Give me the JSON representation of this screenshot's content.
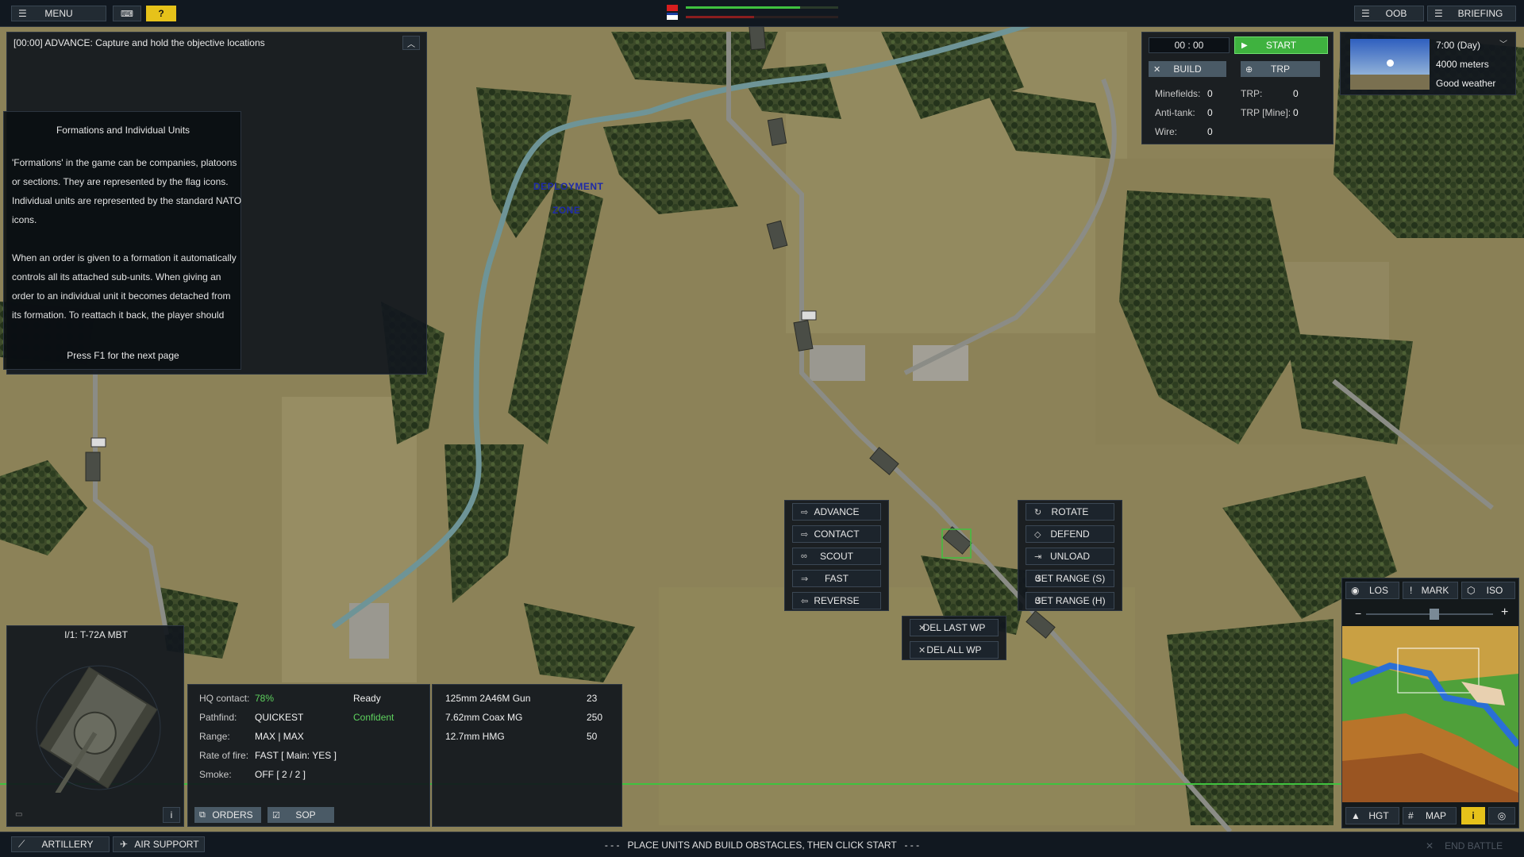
{
  "topbar": {
    "menu_label": "MENU",
    "help_label": "?",
    "oob_label": "OOB",
    "briefing_label": "BRIEFING"
  },
  "mission": {
    "objective": "[00:00] ADVANCE: Capture and hold the objective locations"
  },
  "help_panel": {
    "title": "Formations and Individual Units",
    "lines": [
      "'Formations' in the game can be companies, platoons",
      "or sections. They are represented by the flag icons.",
      "Individual units are represented by the standard NATO",
      "icons.",
      "",
      "When an order is given to a formation it automatically",
      "controls all its attached sub-units. When giving an",
      "order to an individual unit it becomes detached from",
      "its formation. To reattach it back, the player should"
    ],
    "footer": "Press F1 for the next page"
  },
  "deployment": {
    "line1": "DEPLOYMENT",
    "line2": "ZONE"
  },
  "timer": {
    "time": "00 : 00",
    "start_label": "START"
  },
  "build": {
    "build_label": "BUILD",
    "trp_label": "TRP",
    "minefields_label": "Minefields:",
    "minefields_value": "0",
    "antitank_label": "Anti-tank:",
    "antitank_value": "0",
    "wire_label": "Wire:",
    "wire_value": "0",
    "trp_count_label": "TRP:",
    "trp_count_value": "0",
    "trp_mine_label": "TRP [Mine]:",
    "trp_mine_value": "0"
  },
  "weather": {
    "time": "7:00 (Day)",
    "visibility": "4000 meters",
    "condition": "Good weather"
  },
  "orders_left": [
    {
      "label": "ADVANCE",
      "icon": "arrow-right-icon"
    },
    {
      "label": "CONTACT",
      "icon": "contact-arrow-icon"
    },
    {
      "label": "SCOUT",
      "icon": "binoculars-icon"
    },
    {
      "label": "FAST",
      "icon": "fast-arrow-icon"
    },
    {
      "label": "REVERSE",
      "icon": "reverse-arrow-icon"
    }
  ],
  "orders_right": [
    {
      "label": "ROTATE",
      "icon": "rotate-icon"
    },
    {
      "label": "DEFEND",
      "icon": "diamond-icon"
    },
    {
      "label": "UNLOAD",
      "icon": "unload-icon"
    },
    {
      "label": "SET RANGE (S)",
      "icon": "range-icon"
    },
    {
      "label": "SET RANGE (H)",
      "icon": "range-icon"
    }
  ],
  "waypoints": [
    {
      "label": "DEL LAST WP"
    },
    {
      "label": "DEL ALL WP"
    }
  ],
  "minimap": {
    "los_label": "LOS",
    "mark_label": "MARK",
    "iso_label": "ISO",
    "hgt_label": "HGT",
    "map_label": "MAP",
    "zoom_out": "−",
    "zoom_in": "+"
  },
  "unit": {
    "name": "I/1: T-72A MBT",
    "hq_contact_label": "HQ contact:",
    "hq_contact_value": "78%",
    "status": "Ready",
    "pathfind_label": "Pathfind:",
    "pathfind_value": "QUICKEST",
    "morale": "Confident",
    "range_label": "Range:",
    "range_value": "MAX | MAX",
    "rof_label": "Rate of fire:",
    "rof_value": "FAST [ Main: YES ]",
    "smoke_label": "Smoke:",
    "smoke_value": "OFF [ 2 / 2 ]",
    "orders_label": "ORDERS",
    "sop_label": "SOP",
    "weapons": [
      {
        "name": "125mm 2A46M Gun",
        "ammo": "23"
      },
      {
        "name": "7.62mm Coax MG",
        "ammo": "250"
      },
      {
        "name": "12.7mm HMG",
        "ammo": "50"
      }
    ]
  },
  "bottombar": {
    "artillery_label": "ARTILLERY",
    "air_support_label": "AIR SUPPORT",
    "message": "- - -   PLACE UNITS AND BUILD OBSTACLES, THEN CLICK START   - - -",
    "end_battle_label": "END BATTLE"
  },
  "colors": {
    "accent_green": "#3fc23f",
    "accent_yellow": "#e6c21a",
    "panel": "#12181e",
    "deployment_text": "#1e2aa8"
  }
}
